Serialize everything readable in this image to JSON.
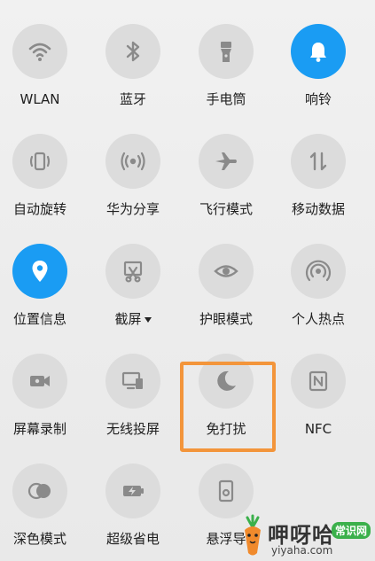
{
  "colors": {
    "active": "#1a9cf3",
    "inactive": "#dcdcdc",
    "icon": "#8a8a8a",
    "highlight": "#f3953b"
  },
  "tiles": [
    {
      "label": "WLAN",
      "icon": "wifi-icon",
      "active": false
    },
    {
      "label": "蓝牙",
      "icon": "bluetooth-icon",
      "active": false
    },
    {
      "label": "手电筒",
      "icon": "flashlight-icon",
      "active": false
    },
    {
      "label": "响铃",
      "icon": "bell-icon",
      "active": true
    },
    {
      "label": "自动旋转",
      "icon": "auto-rotate-icon",
      "active": false
    },
    {
      "label": "华为分享",
      "icon": "share-icon",
      "active": false
    },
    {
      "label": "飞行模式",
      "icon": "airplane-icon",
      "active": false
    },
    {
      "label": "移动数据",
      "icon": "mobile-data-icon",
      "active": false
    },
    {
      "label": "位置信息",
      "icon": "location-icon",
      "active": true
    },
    {
      "label": "截屏",
      "icon": "screenshot-icon",
      "active": false
    },
    {
      "label": "护眼模式",
      "icon": "eye-icon",
      "active": false
    },
    {
      "label": "个人热点",
      "icon": "hotspot-icon",
      "active": false
    },
    {
      "label": "屏幕录制",
      "icon": "screen-record-icon",
      "active": false
    },
    {
      "label": "无线投屏",
      "icon": "wireless-projection-icon",
      "active": false
    },
    {
      "label": "免打扰",
      "icon": "moon-icon",
      "active": false
    },
    {
      "label": "NFC",
      "icon": "nfc-icon",
      "active": false
    },
    {
      "label": "深色模式",
      "icon": "dark-mode-icon",
      "active": false
    },
    {
      "label": "超级省电",
      "icon": "battery-saver-icon",
      "active": false
    },
    {
      "label": "悬浮导",
      "icon": "floating-nav-icon",
      "active": false
    }
  ],
  "watermark": {
    "title": "呷呀哈",
    "badge": "常识网",
    "url": "yiyaha.com"
  }
}
